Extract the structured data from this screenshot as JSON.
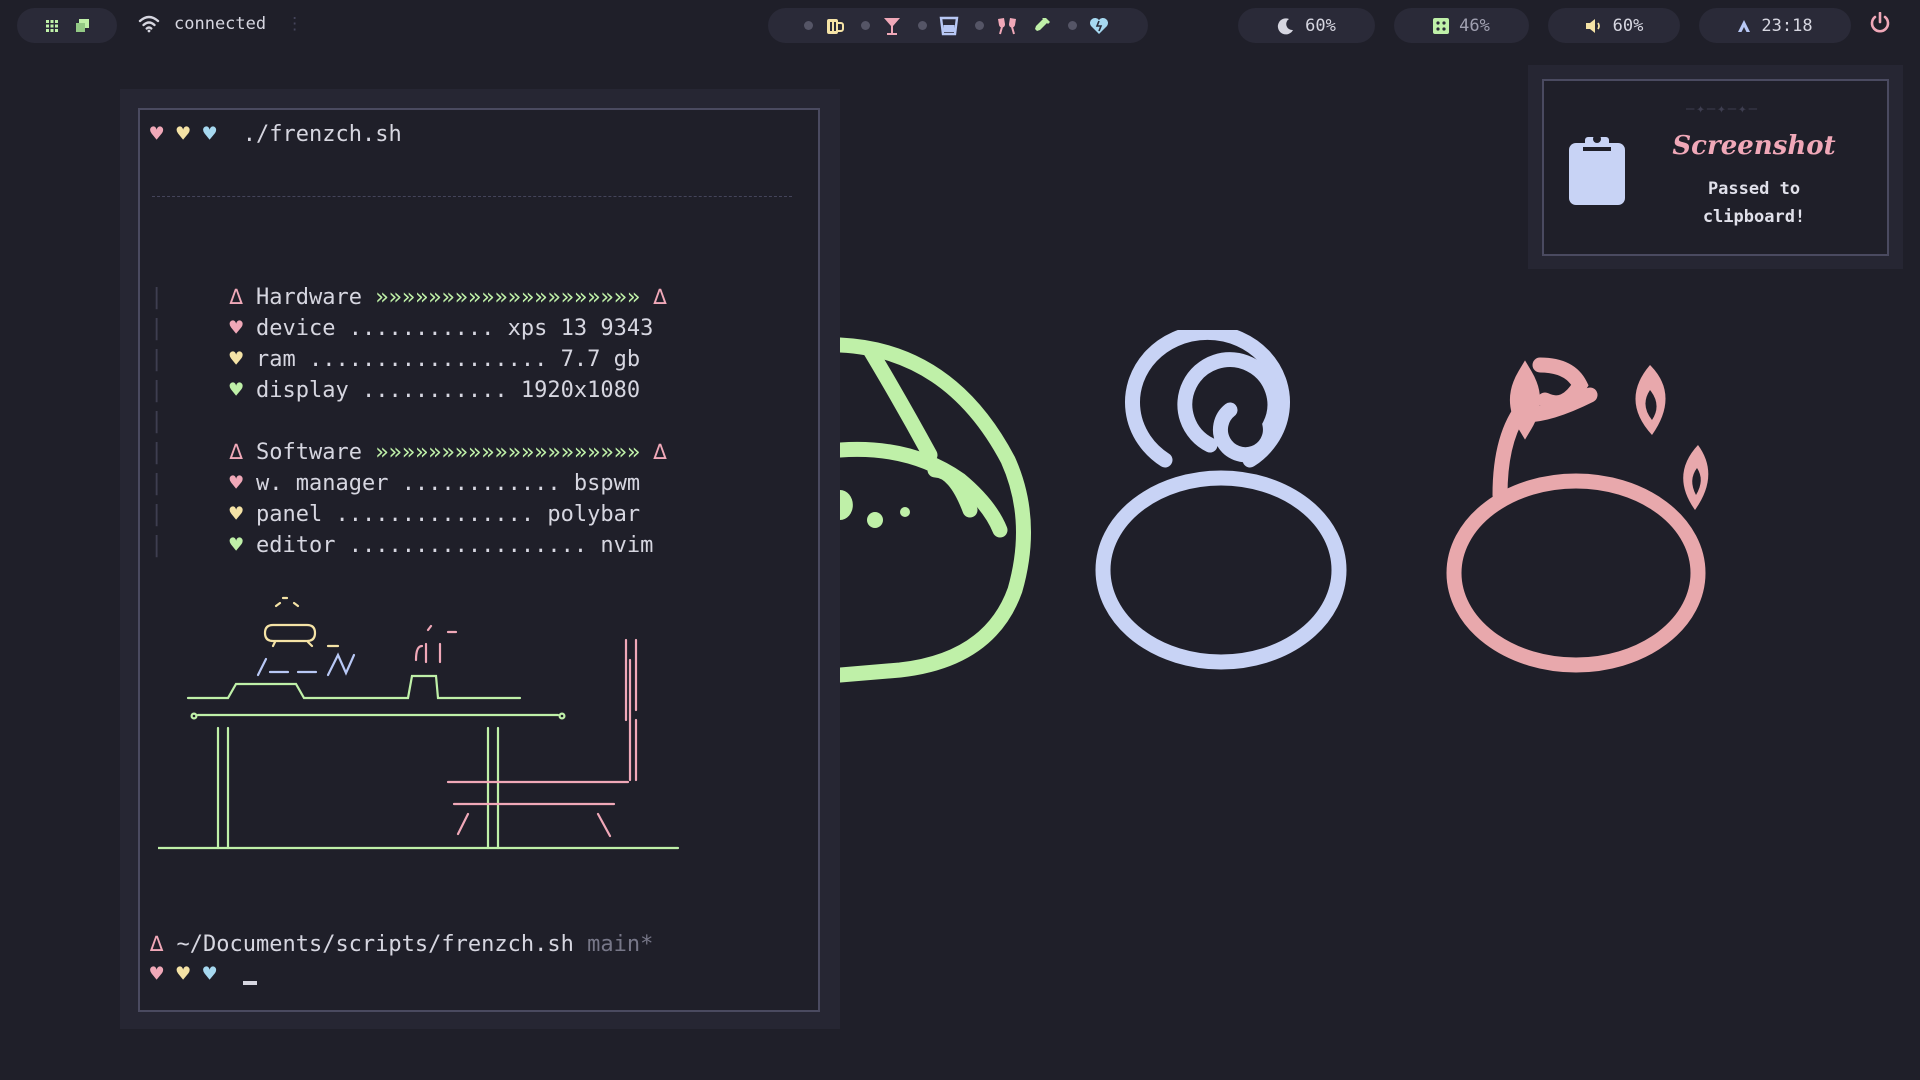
{
  "topbar": {
    "workspaces": [
      {
        "icon": "grid-icon",
        "color": "#bff0a8"
      },
      {
        "icon": "windows-icon",
        "color": "#bff0a8"
      }
    ],
    "network": {
      "icon": "wifi-icon",
      "label": "connected"
    },
    "apps": [
      {
        "icon": "beer-mug-icon",
        "glyph": "🍺",
        "color": "#f5e3a6"
      },
      {
        "icon": "cocktail-icon",
        "glyph": "🍸",
        "color": "#f0a8b8"
      },
      {
        "icon": "glass-icon",
        "glyph": "🥛",
        "color": "#b8c8f5"
      },
      {
        "icon": "glasses-icon",
        "glyph": "🥂",
        "color": "#f0a8b8"
      },
      {
        "icon": "bottle-icon",
        "glyph": "🍾",
        "color": "#bff0a8"
      },
      {
        "icon": "heart-icon",
        "glyph": "💙",
        "color": "#a6d8f0"
      }
    ],
    "brightness": {
      "icon": "moon-icon",
      "value": "60%",
      "color": "#f5e3a6"
    },
    "memory": {
      "icon": "chip-icon",
      "value": "46%",
      "color": "#bff0a8"
    },
    "volume": {
      "icon": "speaker-icon",
      "value": "60%",
      "color": "#f5e3a6"
    },
    "clock": {
      "icon": "user-icon",
      "value": "23:18",
      "color": "#b8c8f5"
    },
    "power": {
      "icon": "power-icon"
    }
  },
  "terminal": {
    "hearts": [
      "♥",
      "♥",
      "♥"
    ],
    "command": "./frenzch.sh",
    "hardware": {
      "header": "Hardware",
      "arrows": "»»»»»»»»»»»»»»»»»»»»",
      "delta": "∆",
      "items": [
        {
          "key": "device",
          "dots": "...........",
          "value": "xps 13 9343"
        },
        {
          "key": "ram",
          "dots": "..................",
          "value": "7.7 gb"
        },
        {
          "key": "display",
          "dots": "...........",
          "value": "1920x1080"
        }
      ]
    },
    "software": {
      "header": "Software",
      "arrows": "»»»»»»»»»»»»»»»»»»»»",
      "delta": "∆",
      "items": [
        {
          "key": "w. manager",
          "dots": "............",
          "value": "bspwm"
        },
        {
          "key": "panel",
          "dots": "...............",
          "value": "polybar"
        },
        {
          "key": "editor",
          "dots": "..................",
          "value": "nvim"
        }
      ]
    },
    "prompt_path": "~/Documents/scripts/frenzch.sh",
    "prompt_branch": "main*"
  },
  "notification": {
    "icon": "clipboard-icon",
    "deco": "—✦—✦—✦—",
    "title": "Screenshot",
    "body": "Passed to\nclipboard!"
  },
  "wallpaper": {
    "icons": [
      {
        "name": "green-creature-icon",
        "color": "#bff0a8"
      },
      {
        "name": "snail-icon",
        "color": "#c8d3f5"
      },
      {
        "name": "flower-creature-icon",
        "color": "#e8a8ac"
      }
    ]
  }
}
